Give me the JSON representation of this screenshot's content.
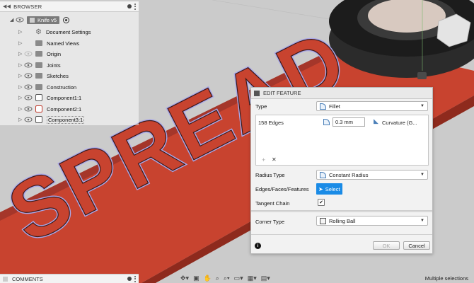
{
  "browser": {
    "title": "BROWSER",
    "document": "Knife v5",
    "items": [
      {
        "label": "Document Settings"
      },
      {
        "label": "Named Views"
      },
      {
        "label": "Origin"
      },
      {
        "label": "Joints"
      },
      {
        "label": "Sketches"
      },
      {
        "label": "Construction"
      },
      {
        "label": "Component1:1"
      },
      {
        "label": "Component2:1"
      },
      {
        "label": "Component3:1"
      }
    ]
  },
  "viewport": {
    "embossed_text": "SPREAD",
    "colors": {
      "body": "#c8432f",
      "body_dark": "#8e2a1d",
      "highlight": "#a9a7e8",
      "ground": "#cfcfcf",
      "cylinder": "#2b2b2b"
    }
  },
  "dialog": {
    "title": "EDIT FEATURE",
    "type_label": "Type",
    "type_value": "Fillet",
    "edges_count": "158 Edges",
    "radius_value": "0.3 mm",
    "curvature_label": "Curvature (G...",
    "add_label": "+",
    "remove_label": "✕",
    "radius_type_label": "Radius Type",
    "radius_type_value": "Constant Radius",
    "edges_faces_label": "Edges/Faces/Features",
    "select_label": "Select",
    "tangent_chain_label": "Tangent Chain",
    "tangent_chain_checked": "✔",
    "corner_type_label": "Corner Type",
    "corner_type_value": "Rolling Ball",
    "info_label": "i",
    "ok_label": "OK",
    "cancel_label": "Cancel",
    "select_color": "#1a8be6"
  },
  "comments": {
    "title": "COMMENTS"
  },
  "status": {
    "text": "Multiple selections"
  }
}
